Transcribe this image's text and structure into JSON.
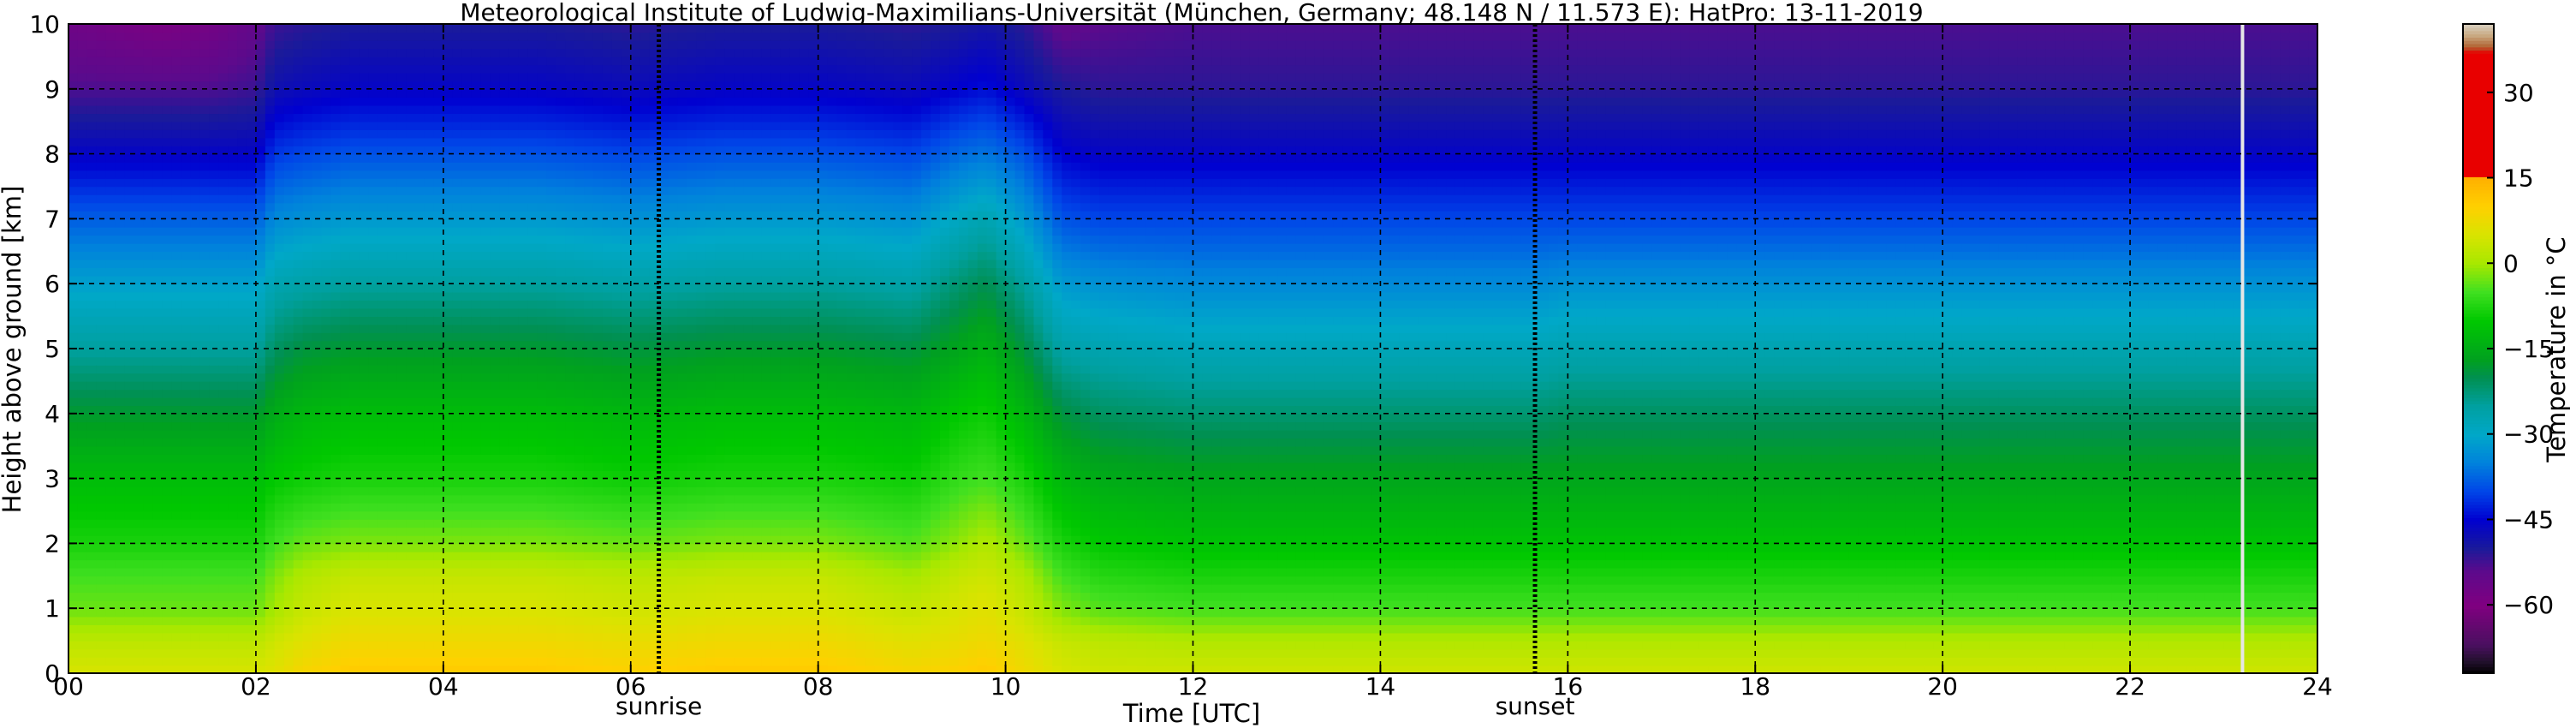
{
  "chart_data": {
    "type": "heatmap",
    "title": "Meteorological Institute of Ludwig-Maximilians-Universität (München, Germany; 48.148 N / 11.573 E):    HatPro: 13-11-2019",
    "xlabel": "Time [UTC]",
    "ylabel": "Height above ground [km]",
    "xlim": [
      0,
      24
    ],
    "ylim": [
      0,
      10
    ],
    "x_ticks": [
      "00",
      "02",
      "04",
      "06",
      "08",
      "10",
      "12",
      "14",
      "16",
      "18",
      "20",
      "22",
      "24"
    ],
    "y_ticks": [
      "0",
      "1",
      "2",
      "3",
      "4",
      "5",
      "6",
      "7",
      "8",
      "9",
      "10"
    ],
    "grid": true,
    "grid_style": "dashed",
    "annotations": [
      {
        "text": "sunrise",
        "x": 6.3
      },
      {
        "text": "sunset",
        "x": 15.65
      }
    ],
    "data_gap_x": 23.2,
    "times": [
      0,
      0.5,
      1,
      1.5,
      2,
      2.2,
      2.5,
      3,
      4,
      5,
      6,
      7,
      8,
      9,
      9.5,
      9.8,
      10.2,
      10.6,
      11,
      12,
      14,
      15.6,
      16,
      18,
      20,
      22,
      23,
      24
    ],
    "temperature_profiles": [
      {
        "height_km": 0.0,
        "values": [
          5,
          5,
          5,
          5,
          5,
          6,
          9,
          11,
          11,
          11,
          10,
          11,
          11,
          9,
          10,
          11,
          8,
          5,
          4,
          4,
          4,
          4,
          4,
          4,
          4,
          4,
          4,
          4
        ]
      },
      {
        "height_km": 0.5,
        "values": [
          2,
          2,
          2,
          2,
          2,
          4,
          6,
          8,
          8,
          8,
          7,
          8,
          8,
          6,
          7,
          8,
          6,
          3,
          2,
          1,
          1,
          1,
          1,
          1,
          1,
          1,
          1,
          1
        ]
      },
      {
        "height_km": 1.0,
        "values": [
          -3,
          -3,
          -3,
          -3,
          -3,
          0,
          3,
          5,
          5,
          5,
          4,
          5,
          5,
          3,
          5,
          6,
          3,
          -2,
          -4,
          -5,
          -5,
          -5,
          -5,
          -5,
          -5,
          -5,
          -5,
          -5
        ]
      },
      {
        "height_km": 1.5,
        "values": [
          -5,
          -5,
          -5,
          -5,
          -5,
          -2,
          1,
          3,
          3,
          3,
          2,
          3,
          3,
          0,
          3,
          4,
          1,
          -5,
          -7,
          -8,
          -8,
          -8,
          -8,
          -8,
          -8,
          -8,
          -8,
          -8
        ]
      },
      {
        "height_km": 2.0,
        "values": [
          -8,
          -8,
          -8,
          -8,
          -8,
          -5,
          -3,
          -2,
          -2,
          -2,
          -3,
          -2,
          -2,
          -4,
          -1,
          1,
          -3,
          -8,
          -10,
          -11,
          -11,
          -11,
          -11,
          -11,
          -11,
          -11,
          -11,
          -11
        ]
      },
      {
        "height_km": 3.0,
        "values": [
          -12,
          -12,
          -12,
          -12,
          -12,
          -10,
          -9,
          -8,
          -8,
          -8,
          -9,
          -8,
          -8,
          -9,
          -6,
          -5,
          -8,
          -13,
          -15,
          -16,
          -16,
          -16,
          -16,
          -16,
          -16,
          -16,
          -16,
          -16
        ]
      },
      {
        "height_km": 4.0,
        "values": [
          -18,
          -18,
          -18,
          -18,
          -18,
          -15,
          -13,
          -12,
          -12,
          -12,
          -13,
          -12,
          -12,
          -13,
          -10,
          -9,
          -13,
          -19,
          -21,
          -22,
          -22,
          -22,
          -21,
          -21,
          -21,
          -21,
          -21,
          -21
        ]
      },
      {
        "height_km": 5.0,
        "values": [
          -25,
          -25,
          -25,
          -25,
          -25,
          -21,
          -19,
          -18,
          -18,
          -18,
          -19,
          -18,
          -18,
          -19,
          -16,
          -14,
          -19,
          -26,
          -27,
          -28,
          -28,
          -28,
          -27,
          -27,
          -27,
          -27,
          -27,
          -27
        ]
      },
      {
        "height_km": 6.0,
        "values": [
          -31,
          -31,
          -31,
          -31,
          -31,
          -27,
          -26,
          -25,
          -25,
          -25,
          -26,
          -25,
          -25,
          -26,
          -22,
          -20,
          -25,
          -32,
          -33,
          -34,
          -34,
          -34,
          -33,
          -33,
          -33,
          -33,
          -33,
          -33
        ]
      },
      {
        "height_km": 7.0,
        "values": [
          -38,
          -38,
          -38,
          -38,
          -38,
          -34,
          -33,
          -32,
          -32,
          -32,
          -33,
          -32,
          -32,
          -33,
          -29,
          -27,
          -32,
          -39,
          -40,
          -40,
          -40,
          -40,
          -40,
          -40,
          -40,
          -40,
          -40,
          -40
        ]
      },
      {
        "height_km": 8.0,
        "values": [
          -46,
          -46,
          -46,
          -46,
          -46,
          -41,
          -40,
          -39,
          -39,
          -39,
          -40,
          -39,
          -39,
          -40,
          -37,
          -36,
          -39,
          -45,
          -46,
          -46,
          -46,
          -46,
          -46,
          -46,
          -46,
          -46,
          -46,
          -46
        ]
      },
      {
        "height_km": 9.0,
        "values": [
          -53,
          -53,
          -53,
          -53,
          -52,
          -48,
          -47,
          -46,
          -46,
          -46,
          -47,
          -46,
          -46,
          -47,
          -45,
          -44,
          -47,
          -50,
          -51,
          -51,
          -51,
          -51,
          -51,
          -51,
          -51,
          -51,
          -51,
          -51
        ]
      },
      {
        "height_km": 10.0,
        "values": [
          -57,
          -58,
          -59,
          -58,
          -55,
          -52,
          -51,
          -50,
          -50,
          -50,
          -51,
          -50,
          -50,
          -51,
          -50,
          -49,
          -51,
          -55,
          -54,
          -53,
          -53,
          -53,
          -53,
          -53,
          -53,
          -53,
          -53,
          -53
        ]
      }
    ],
    "colorbar": {
      "label": "Temperature in °C",
      "range": [
        -72,
        42
      ],
      "ticks": [
        "30",
        "15",
        "0",
        "−15",
        "−30",
        "−45",
        "−60"
      ],
      "tick_values": [
        30,
        15,
        0,
        -15,
        -30,
        -45,
        -60
      ],
      "stops": [
        {
          "t": -72,
          "color": "#000000"
        },
        {
          "t": -70,
          "color": "#20102a"
        },
        {
          "t": -67,
          "color": "#4a1060"
        },
        {
          "t": -60,
          "color": "#800080"
        },
        {
          "t": -54,
          "color": "#5c0a8c"
        },
        {
          "t": -50,
          "color": "#1a1a9a"
        },
        {
          "t": -45,
          "color": "#0000d0"
        },
        {
          "t": -40,
          "color": "#0046e8"
        },
        {
          "t": -35,
          "color": "#0082dc"
        },
        {
          "t": -30,
          "color": "#00a8c8"
        },
        {
          "t": -25,
          "color": "#00a0a0"
        },
        {
          "t": -20,
          "color": "#009050"
        },
        {
          "t": -17,
          "color": "#00a020"
        },
        {
          "t": -10,
          "color": "#00c800"
        },
        {
          "t": -5,
          "color": "#40e020"
        },
        {
          "t": 0,
          "color": "#a8e800"
        },
        {
          "t": 5,
          "color": "#d8e400"
        },
        {
          "t": 10,
          "color": "#ffd000"
        },
        {
          "t": 15,
          "color": "#ffb000"
        },
        {
          "t": 15.01,
          "color": "#e80000"
        },
        {
          "t": 37,
          "color": "#e80000"
        },
        {
          "t": 38,
          "color": "#b06030"
        },
        {
          "t": 40,
          "color": "#c8a880"
        },
        {
          "t": 42,
          "color": "#d8d0c0"
        }
      ]
    }
  }
}
